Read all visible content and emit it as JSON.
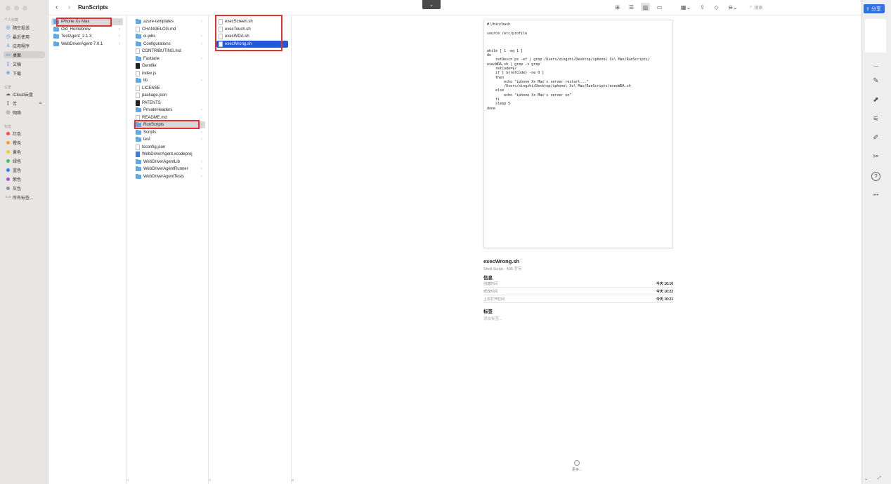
{
  "window": {
    "title": "RunScripts",
    "nav_back": "‹",
    "nav_forward": "›",
    "dropdown_glyph": "⌄"
  },
  "sidebar": {
    "sections": [
      {
        "title": "个人收藏"
      },
      {
        "title": "位置"
      },
      {
        "title": "标签"
      }
    ],
    "favorites": [
      {
        "label": "隔空投送",
        "icon": "airdrop-icon",
        "glyph": "◎"
      },
      {
        "label": "最近使用",
        "icon": "clock-icon",
        "glyph": "◷"
      },
      {
        "label": "应用程序",
        "icon": "applications-icon",
        "glyph": "⅄"
      },
      {
        "label": "桌面",
        "icon": "desktop-icon",
        "glyph": "▭",
        "selected": true
      },
      {
        "label": "文稿",
        "icon": "document-icon",
        "glyph": "▯"
      },
      {
        "label": "下载",
        "icon": "download-icon",
        "glyph": "⊕"
      }
    ],
    "locations": [
      {
        "label": "iCloud云盘",
        "icon": "cloud-icon",
        "glyph": "☁"
      },
      {
        "label": "芳",
        "icon": "drive-icon",
        "glyph": "▯",
        "eject": "⏏"
      },
      {
        "label": "网络",
        "icon": "network-icon",
        "glyph": "◎"
      }
    ],
    "tags": [
      {
        "label": "红色",
        "color": "#ff4a3d"
      },
      {
        "label": "橙色",
        "color": "#ff9a1f"
      },
      {
        "label": "黄色",
        "color": "#f6cc1b"
      },
      {
        "label": "绿色",
        "color": "#35c759"
      },
      {
        "label": "蓝色",
        "color": "#2f7cf6"
      },
      {
        "label": "紫色",
        "color": "#a655d8"
      },
      {
        "label": "灰色",
        "color": "#8e8e93"
      }
    ],
    "all_tags": {
      "label": "所有标签...",
      "glyph": "⊂⊃"
    }
  },
  "toolbar": {
    "icons": [
      {
        "name": "icon-view-icon",
        "glyph": "⊞"
      },
      {
        "name": "list-view-icon",
        "glyph": "☰"
      },
      {
        "name": "column-view-icon",
        "glyph": "▥",
        "active": true
      },
      {
        "name": "gallery-view-icon",
        "glyph": "▭"
      },
      {
        "name": "group-icon",
        "glyph": "▦⌄"
      },
      {
        "name": "share-icon",
        "glyph": "⇪"
      },
      {
        "name": "tag-icon",
        "glyph": "◇"
      },
      {
        "name": "more-actions-icon",
        "glyph": "⊖⌄"
      }
    ],
    "search": {
      "glyph": "⌕",
      "placeholder": "搜索"
    }
  },
  "column1": {
    "items": [
      {
        "label": "iPhone Xs Max",
        "type": "folder",
        "chevron": "›",
        "highlighted": true
      },
      {
        "label": "Old_Homebrew",
        "type": "folder",
        "chevron": "›"
      },
      {
        "label": "TestAgent_2.1.3",
        "type": "folder",
        "chevron": "›"
      },
      {
        "label": "WebDriverAgent-7.0.1",
        "type": "folder",
        "chevron": "›"
      }
    ]
  },
  "column2": {
    "items": [
      {
        "label": "azure-templates",
        "type": "folder",
        "chevron": "›"
      },
      {
        "label": "CHANGELOG.md",
        "type": "doc"
      },
      {
        "label": "ci-jobs",
        "type": "folder",
        "chevron": "›"
      },
      {
        "label": "Configurations",
        "type": "folder",
        "chevron": "›"
      },
      {
        "label": "CONTRIBUTING.md",
        "type": "doc"
      },
      {
        "label": "Fastlane",
        "type": "folder",
        "chevron": "›"
      },
      {
        "label": "Gemfile",
        "type": "dark"
      },
      {
        "label": "index.js",
        "type": "doc"
      },
      {
        "label": "lib",
        "type": "folder",
        "chevron": "›"
      },
      {
        "label": "LICENSE",
        "type": "doc"
      },
      {
        "label": "package.json",
        "type": "doc"
      },
      {
        "label": "PATENTS",
        "type": "dark"
      },
      {
        "label": "PrivateHeaders",
        "type": "folder",
        "chevron": "›"
      },
      {
        "label": "README.md",
        "type": "doc"
      },
      {
        "label": "RunScripts",
        "type": "folder",
        "chevron": "›",
        "highlighted": true
      },
      {
        "label": "Scripts",
        "type": "folder",
        "chevron": "›"
      },
      {
        "label": "test",
        "type": "folder",
        "chevron": "›"
      },
      {
        "label": "tsconfig.json",
        "type": "doc"
      },
      {
        "label": "WebDriverAgent.xcodeproj",
        "type": "blue"
      },
      {
        "label": "WebDriverAgentLib",
        "type": "folder",
        "chevron": "›"
      },
      {
        "label": "WebDriverAgentRunner",
        "type": "folder",
        "chevron": "›"
      },
      {
        "label": "WebDriverAgentTests",
        "type": "folder",
        "chevron": "›"
      }
    ]
  },
  "column3": {
    "items": [
      {
        "label": "execScreen.sh",
        "type": "doc"
      },
      {
        "label": "execTouch.sh",
        "type": "doc"
      },
      {
        "label": "execWDA.sh",
        "type": "doc"
      },
      {
        "label": "execWrong.sh",
        "type": "doc",
        "selected": true
      }
    ]
  },
  "preview": {
    "code": "#!/bin/bash\n\nsource /etc/profile\n\n\n\nwhile [ 1 -eq 1 ]\ndo\n    retDesc=`ps -ef | grep /Users/xingzhi/Desktop/iphone\\ Xs\\ Max/RunScripts/\nexecWDA.sh | grep -v grep`\n    retCode=$?\n    if [ ${retCode} -ne 0 ]\n    then\n        echo \"iphone Xs Max's server restart...\"\n        /Users/xingzhi/Desktop/iphone\\ Xs\\ Max/RunScripts/execWDA.sh\n    else\n        echo \"iphone Xs Max's server on\"\n    fi\n    sleep 5\ndone",
    "file_name": "execWrong.sh",
    "file_kind": "Shell Script - 405 字节",
    "info_title": "信息",
    "info": [
      {
        "key": "创建时间",
        "value": "今天 10:16"
      },
      {
        "key": "修改时间",
        "value": "今天 10:22"
      },
      {
        "key": "上次打开时间",
        "value": "今天 10:21"
      }
    ],
    "tags_title": "标签",
    "add_tag": "添加标签...",
    "more_glyph": "⋯",
    "more_label": "更多..."
  },
  "right_panel": {
    "share_label": "分享",
    "share_glyph": "⇪",
    "icons": [
      {
        "name": "minus-icon",
        "glyph": "—"
      },
      {
        "name": "pen-icon",
        "glyph": "✎"
      },
      {
        "name": "cursor-icon",
        "glyph": "⬈"
      },
      {
        "name": "sliders-icon",
        "glyph": "⚟"
      },
      {
        "name": "edit-box-icon",
        "glyph": "✐"
      },
      {
        "name": "tools-icon",
        "glyph": "✂"
      },
      {
        "name": "help-icon",
        "glyph": "?"
      },
      {
        "name": "more-icon",
        "glyph": "•••"
      }
    ],
    "bottom_left": "⌄",
    "bottom_right": "⤢"
  },
  "colors": {
    "selection": "#2358d9",
    "highlight": "#d9d9d9",
    "annotation_red": "#e53030",
    "share_blue": "#2f6fe8",
    "folder_blue": "#5fa9e8"
  }
}
